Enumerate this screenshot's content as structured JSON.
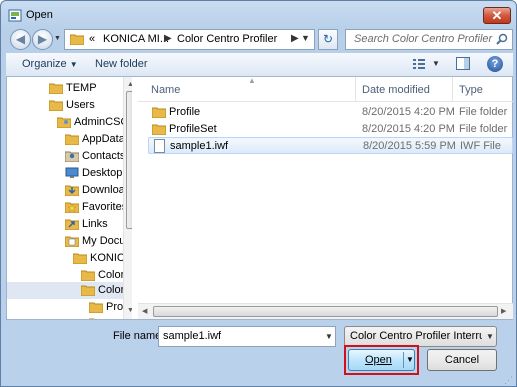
{
  "window": {
    "title": "Open",
    "close_label": "✕"
  },
  "nav": {
    "breadcrumbs": [
      "«",
      "KONICA MI...",
      "Color Centro Profiler"
    ],
    "search_placeholder": "Search Color Centro Profiler"
  },
  "toolbar": {
    "organize": "Organize",
    "new_folder": "New folder",
    "help": "?"
  },
  "tree": [
    {
      "label": "TEMP",
      "icon": "folder"
    },
    {
      "label": "Users",
      "icon": "folder"
    },
    {
      "label": "AdminCSO",
      "icon": "user-folder"
    },
    {
      "label": "AppData",
      "icon": "folder"
    },
    {
      "label": "Contacts",
      "icon": "contacts-folder"
    },
    {
      "label": "Desktop",
      "icon": "desktop-folder"
    },
    {
      "label": "Downloads",
      "icon": "downloads-folder"
    },
    {
      "label": "Favorites",
      "icon": "favorites-folder"
    },
    {
      "label": "Links",
      "icon": "links-folder"
    },
    {
      "label": "My Documents",
      "icon": "documents-folder"
    },
    {
      "label": "KONICA",
      "icon": "folder"
    },
    {
      "label": "Color",
      "icon": "folder"
    },
    {
      "label": "Color",
      "icon": "folder"
    },
    {
      "label": "Pro",
      "icon": "folder"
    },
    {
      "label": "",
      "icon": "folder"
    }
  ],
  "columns": {
    "name": "Name",
    "date": "Date modified",
    "type": "Type"
  },
  "files": [
    {
      "name": "Profile",
      "date": "8/20/2015 4:20 PM",
      "type": "File folder",
      "icon": "folder"
    },
    {
      "name": "ProfileSet",
      "date": "8/20/2015 4:20 PM",
      "type": "File folder",
      "icon": "folder"
    },
    {
      "name": "sample1.iwf",
      "date": "8/20/2015 5:59 PM",
      "type": "IWF File",
      "icon": "file",
      "selected": true
    }
  ],
  "footer": {
    "file_name_label": "File name:",
    "file_name_value": "sample1.iwf",
    "filter": "Color Centro Profiler Interrupt f",
    "open": "Open",
    "cancel": "Cancel"
  },
  "colors": {
    "highlight": "#d0101a",
    "selection": "#dceaf9"
  }
}
